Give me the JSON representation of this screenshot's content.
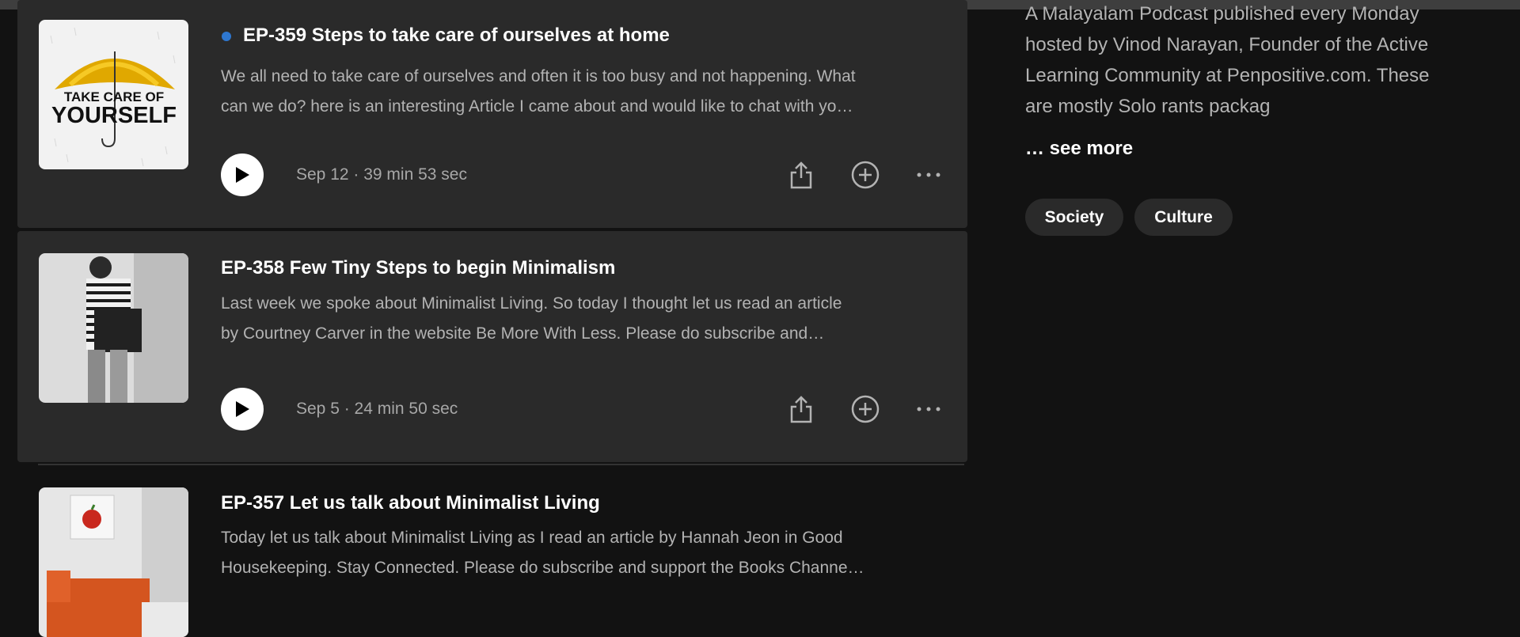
{
  "episodes": [
    {
      "title": "EP-359 Steps to take care of ourselves at home",
      "unplayed": true,
      "thumb_text": [
        "TAKE CARE OF",
        "YOURSELF"
      ],
      "desc_lines": [
        "We all need to take care of ourselves and often it is too busy and not happening. What",
        "can we do? here is an interesting Article I came about and would like to chat with yo…"
      ],
      "meta": "Sep 12 · 39 min 53 sec"
    },
    {
      "title": "EP-358 Few Tiny Steps to begin Minimalism",
      "unplayed": false,
      "desc_lines": [
        "Last week we spoke about Minimalist Living. So today I thought let us read an article",
        "by Courtney Carver in the website Be More With Less.  Please do subscribe and…"
      ],
      "meta": "Sep 5 · 24 min 50 sec"
    },
    {
      "title": "EP-357 Let us talk about Minimalist Living",
      "unplayed": false,
      "desc_lines": [
        "Today let us talk about Minimalist Living as I read an article by Hannah Jeon in Good",
        "Housekeeping. Stay Connected. Please do subscribe and support the Books Channe…"
      ]
    }
  ],
  "about": {
    "desc_lines": [
      "A Malayalam Podcast published every Monday",
      "hosted by Vinod Narayan, Founder of the Active",
      "Learning Community at Penpositive.com. These",
      "are mostly Solo rants packag"
    ],
    "see_more": "… see more",
    "tags": [
      "Society",
      "Culture"
    ]
  },
  "icons": [
    "play-icon",
    "share-icon",
    "add-circle-icon",
    "more-options-icon"
  ],
  "colors": {
    "background": "#121212",
    "card": "#2a2a2a",
    "unplayed_dot": "#2e77d0",
    "muted_text": "#b3b3b3"
  }
}
